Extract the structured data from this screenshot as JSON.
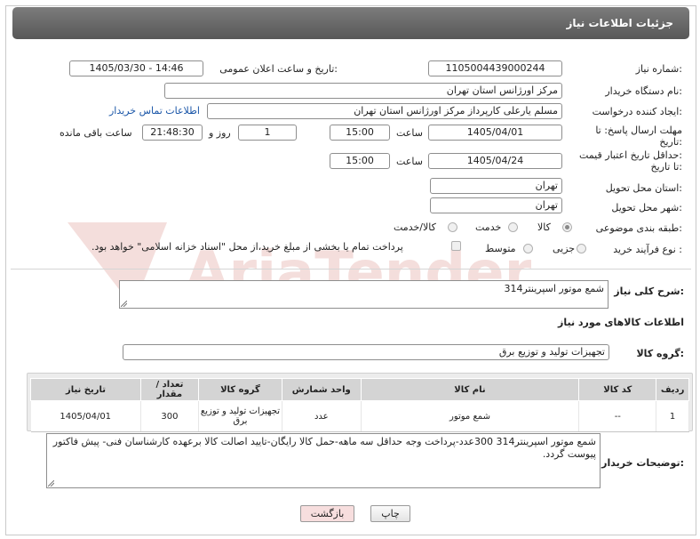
{
  "header": {
    "title": "جزئیات اطلاعات نیاز"
  },
  "form": {
    "need_number_label": "شماره نیاز:",
    "need_number": "1105004439000244",
    "announce_label": "تاریخ و ساعت اعلان عمومی:",
    "announce_value": "1405/03/30 - 14:46",
    "buyer_org_label": "نام دستگاه خریدار:",
    "buyer_org": "مرکز اورژانس استان تهران",
    "creator_label": "ایجاد کننده درخواست:",
    "creator": "مسلم یارعلی کارپرداز مرکز اورژانس استان تهران",
    "contact_link": "اطلاعات تماس خریدار",
    "reply_deadline_label_1": "مهلت ارسال پاسخ: تا",
    "reply_deadline_label_2": "تاریخ:",
    "reply_date": "1405/04/01",
    "time_label": "ساعت",
    "reply_time": "15:00",
    "days_value": "1",
    "days_label": "روز و",
    "remaining_time": "21:48:30",
    "remaining_label": "ساعت باقی مانده",
    "price_deadline_label_1": "حداقل تاریخ اعتبار قیمت:",
    "price_deadline_label_2": "تا تاریخ:",
    "price_date": "1405/04/24",
    "price_time": "15:00",
    "province_label": "استان محل تحویل:",
    "province": "تهران",
    "city_label": "شهر محل تحویل:",
    "city": "تهران",
    "category_label": "طبقه بندی موضوعی:",
    "category_options": [
      "کالا",
      "خدمت",
      "کالا/خدمت"
    ],
    "process_label": "نوع فرآیند خرید :",
    "process_options": [
      "جزیی",
      "متوسط"
    ],
    "payment_note": "پرداخت تمام یا بخشی از مبلغ خرید،از محل \"اسناد خزانه اسلامی\" خواهد بود."
  },
  "description": {
    "label": "شرح کلی نیاز:",
    "value": "شمع موتور اسپرینتر314"
  },
  "goods": {
    "section_title": "اطلاعات کالاهای مورد نیاز",
    "group_label": "گروه کالا:",
    "group_value": "تجهیزات تولید و توزیع برق",
    "columns": [
      "ردیف",
      "کد کالا",
      "نام کالا",
      "واحد شمارش",
      "گروه کالا",
      "تعداد / مقدار",
      "تاریخ نیاز"
    ],
    "rows": [
      {
        "row": "1",
        "code": "--",
        "name": "شمع موتور",
        "unit": "عدد",
        "group": "تجهیزات تولید و توزیع برق",
        "qty": "300",
        "date": "1405/04/01"
      }
    ]
  },
  "buyer_notes": {
    "label": "توضیحات خریدار:",
    "value": "شمع موتور اسپرینتر314      300عدد-پرداخت وجه حداقل سه ماهه-حمل کالا رایگان-تایید اصالت کالا برعهده کارشناسان فنی- پیش فاکتور پیوست گردد."
  },
  "buttons": {
    "print": "چاپ",
    "back": "بازگشت"
  },
  "watermark": {
    "text": "AriaTender.net"
  },
  "colors": {
    "header": "#6a6a6a",
    "link": "#1a56a8",
    "back_button": "#f7dede",
    "table_header": "#d4d4d4",
    "watermark": "#c0392b"
  }
}
